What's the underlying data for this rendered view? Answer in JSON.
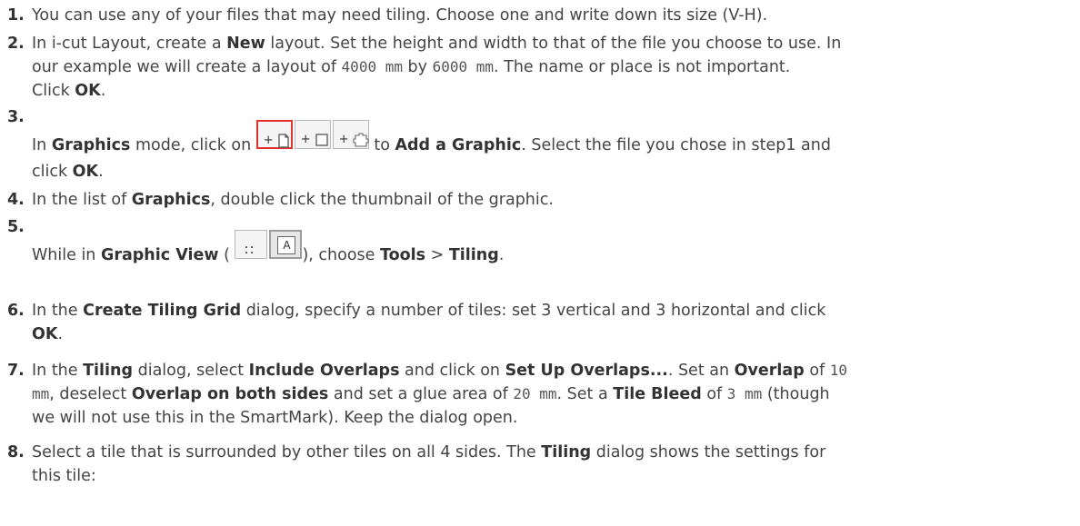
{
  "steps": [
    {
      "num": "1.",
      "text": "You can use any of your files that may need tiling. Choose one and write down its size (V-H)."
    },
    {
      "num": "2.",
      "l1a": "In i-cut Layout, create a ",
      "l1b": "New",
      "l1c": " layout. Set the height and width to that of the file you choose to use. In",
      "l2a": "our example we will create a layout of ",
      "l2b": "4000 mm",
      "l2c": " by ",
      "l2d": "6000 mm",
      "l2e": ". The name or place is not important.",
      "l3a": "Click ",
      "l3b": "OK",
      "l3c": "."
    },
    {
      "num": "3.",
      "a": "In ",
      "b": "Graphics",
      "c": " mode, click on ",
      "d": " to ",
      "e": "Add a Graphic",
      "f": ". Select the file you chose in step1 and",
      "g": "click ",
      "h": "OK",
      "i": "."
    },
    {
      "num": "4.",
      "a": "In the list of ",
      "b": "Graphics",
      "c": ", double click the thumbnail of the graphic."
    },
    {
      "num": "5.",
      "a": "While in ",
      "b": "Graphic View",
      "c": " (",
      "d": "), choose ",
      "e": "Tools",
      "f": " > ",
      "g": "Tiling",
      "h": "."
    },
    {
      "num": "6.",
      "a": "In the ",
      "b": "Create Tiling Grid",
      "c": " dialog, specify a number of tiles: set 3 vertical and 3 horizontal and click",
      "d": "OK",
      "e": "."
    },
    {
      "num": "7.",
      "a": "In the ",
      "b": "Tiling",
      "c": " dialog, select ",
      "d": "Include Overlaps",
      "e": " and click on ",
      "f": "Set Up Overlaps...",
      "g": ". Set an ",
      "h": "Overlap",
      "i": " of ",
      "j": "10",
      "k": "mm",
      "l": ", deselect ",
      "m": "Overlap on both sides",
      "n": " and set a glue area of ",
      "o": "20 mm",
      "p": ". Set a ",
      "q": "Tile Bleed",
      "r": " of ",
      "s": "3 mm",
      "t": " (though",
      "u": "we will not use this in the SmartMark). Keep the dialog open."
    },
    {
      "num": "8.",
      "a": "Select a tile that is surrounded by other tiles on all 4 sides. The ",
      "b": "Tiling",
      "c": " dialog shows the settings for",
      "d": "this tile:"
    }
  ],
  "icons": {
    "add_graphic": "+",
    "add_rect": "+",
    "add_shape": "+",
    "grid_view": "::",
    "graphic_view": "A"
  }
}
